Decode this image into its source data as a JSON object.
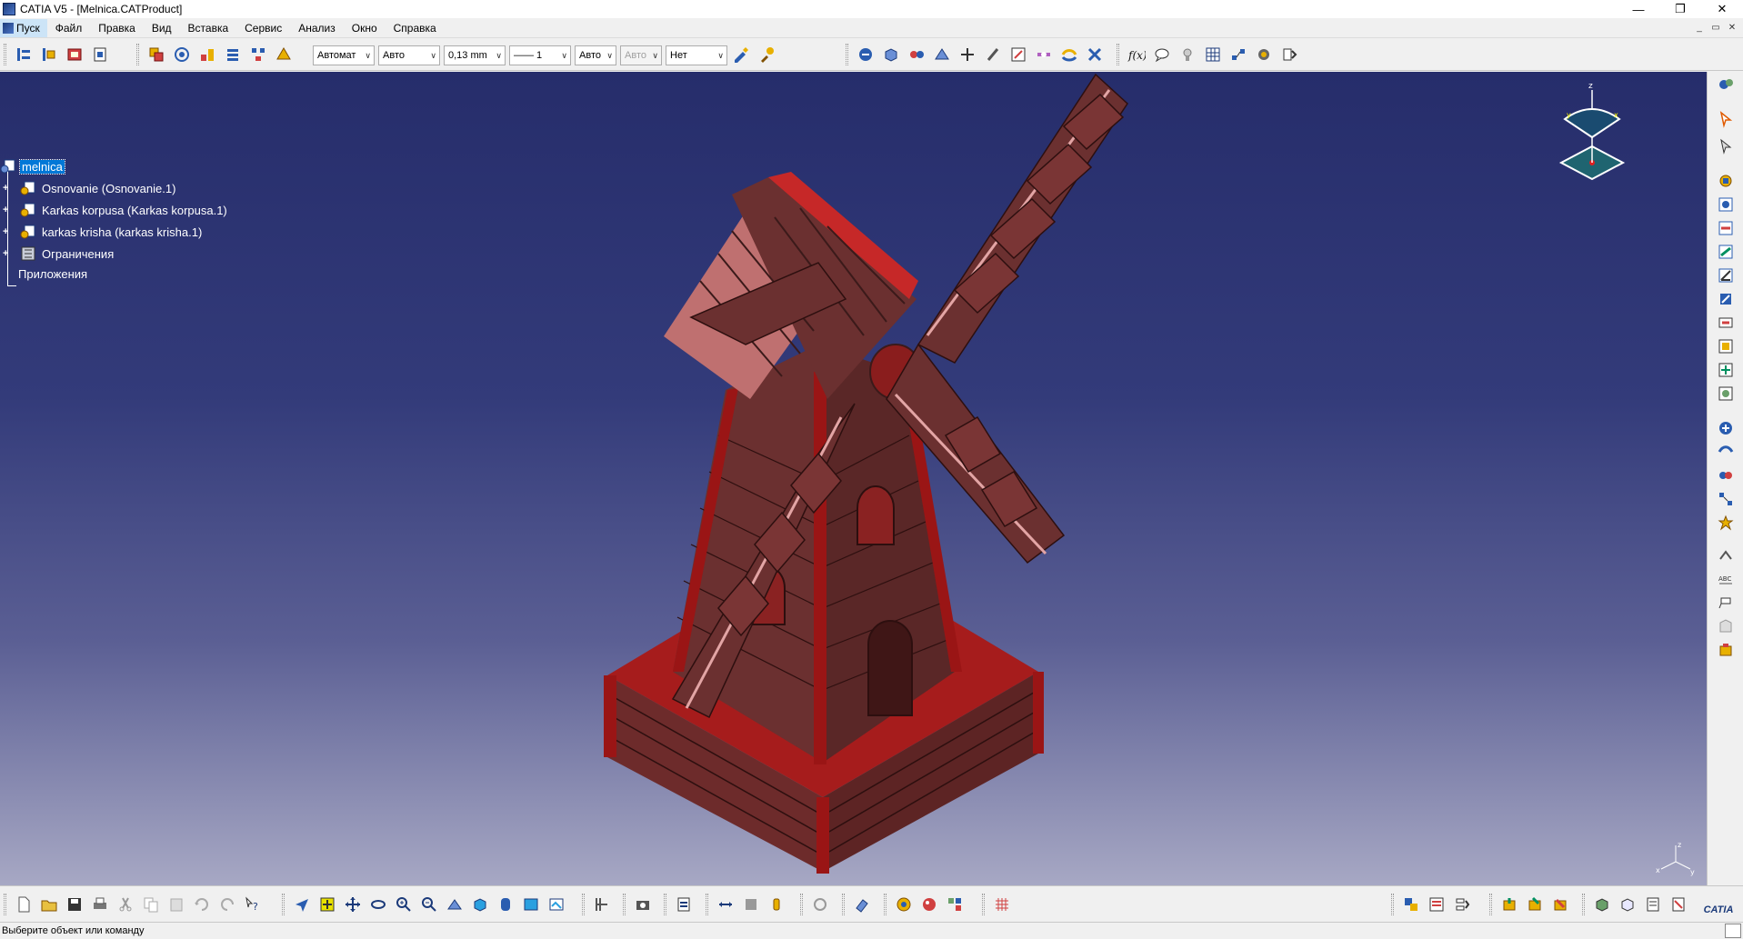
{
  "window": {
    "title": "CATIA V5 - [Melnica.CATProduct]"
  },
  "menu": {
    "start_label": "Пуск",
    "items": [
      "Файл",
      "Правка",
      "Вид",
      "Вставка",
      "Сервис",
      "Анализ",
      "Окно",
      "Справка"
    ]
  },
  "graphic_properties": {
    "color": "Автомат",
    "transparency": "Авто",
    "line_thickness": "0,13 mm",
    "line_type": "—— 1",
    "point_symbol": "Авто",
    "render_style": "Авто",
    "layer": "Нет"
  },
  "tree": {
    "root": "melnica",
    "children": [
      "Osnovanie (Osnovanie.1)",
      "Karkas korpusa (Karkas korpusa.1)",
      "karkas krisha (karkas krisha.1)",
      "Ограничения"
    ],
    "applications": "Приложения"
  },
  "compass": {
    "z_label": "z",
    "x_label": "x",
    "y_label": "y"
  },
  "brand": "CATIA",
  "status": {
    "message": "Выберите объект или команду"
  },
  "colors": {
    "viewport_top": "#262d6b",
    "viewport_bottom": "#a7a8c4",
    "model_red": "#7a1414",
    "model_wood": "#6e3b3b",
    "selection": "#0078d7"
  }
}
